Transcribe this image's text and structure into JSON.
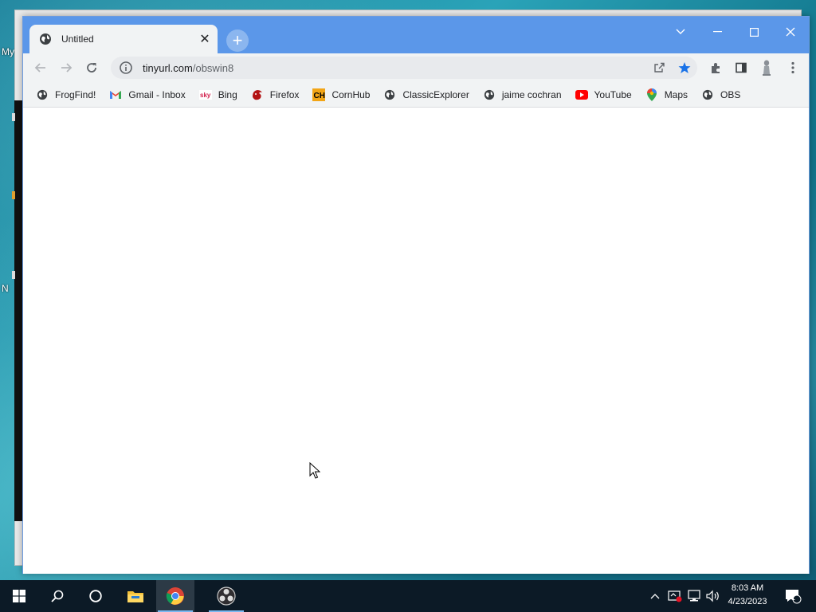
{
  "desktop": {
    "icon_label_1": "My",
    "icon_label_2": "N"
  },
  "browser": {
    "tab": {
      "title": "Untitled"
    },
    "address": {
      "host": "tinyurl.com",
      "path": "/obswin8"
    },
    "bookmarks": [
      {
        "label": "FrogFind!",
        "icon": "globe-icon"
      },
      {
        "label": "Gmail - Inbox",
        "icon": "gmail-icon"
      },
      {
        "label": "Bing",
        "icon": "sky-icon"
      },
      {
        "label": "Firefox",
        "icon": "firefox-icon"
      },
      {
        "label": "CornHub",
        "icon": "ch-icon"
      },
      {
        "label": "ClassicExplorer",
        "icon": "globe-icon"
      },
      {
        "label": "jaime cochran",
        "icon": "globe-icon"
      },
      {
        "label": "YouTube",
        "icon": "youtube-icon"
      },
      {
        "label": "Maps",
        "icon": "maps-icon"
      },
      {
        "label": "OBS",
        "icon": "globe-icon"
      }
    ],
    "colors": {
      "titlebar": "#5b97e9",
      "star": "#1a73e8"
    }
  },
  "taskbar": {
    "time": "8:03 AM",
    "date": "4/23/2023",
    "notification_count": "1"
  }
}
